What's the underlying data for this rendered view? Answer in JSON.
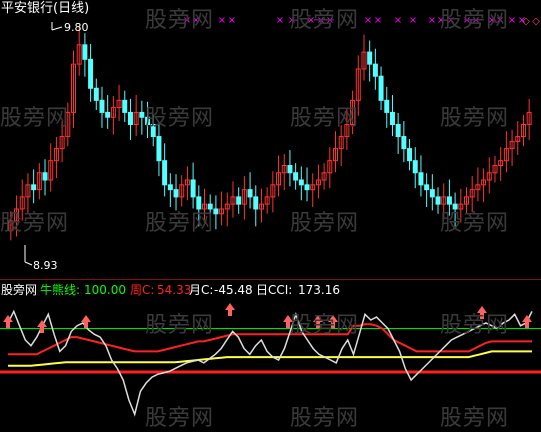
{
  "chart_title": "平安银行(日线)",
  "upper_panel": {
    "max_price_label": "9.80",
    "min_price_label": "8.93",
    "marker_glyph": "×",
    "diamond_glyph": "◇",
    "marker_color": "#ff00ff",
    "up_color": "#ff3232",
    "down_color": "#54ffff"
  },
  "watermark_text": "股旁网",
  "indicator_bar": {
    "name": "股旁网",
    "bull_line_label": "牛熊线:",
    "bull_line_value": "100.00",
    "week_label": "周C:",
    "week_value": "54.33",
    "month_label": "月C:",
    "month_value": "-45.48",
    "day_label": "日CCI:",
    "day_value": "173.16"
  },
  "colors": {
    "bull_line": "#00ff00",
    "week": "#ff2020",
    "month": "#ffff40",
    "day": "#dddddd",
    "divider": "#7a1010",
    "arrow": "#ff6060"
  },
  "chart_data": [
    {
      "type": "candlestick",
      "title": "平安银行(日线)",
      "annotations": [
        "9.80",
        "8.93"
      ],
      "close": [
        9.05,
        9.1,
        9.15,
        9.2,
        9.18,
        9.25,
        9.22,
        9.3,
        9.35,
        9.4,
        9.5,
        9.7,
        9.78,
        9.72,
        9.6,
        9.55,
        9.5,
        9.48,
        9.52,
        9.55,
        9.5,
        9.45,
        9.5,
        9.48,
        9.45,
        9.4,
        9.3,
        9.2,
        9.18,
        9.15,
        9.2,
        9.22,
        9.15,
        9.1,
        9.12,
        9.1,
        9.08,
        9.1,
        9.12,
        9.15,
        9.12,
        9.18,
        9.15,
        9.1,
        9.12,
        9.15,
        9.2,
        9.25,
        9.28,
        9.25,
        9.22,
        9.2,
        9.18,
        9.2,
        9.22,
        9.25,
        9.3,
        9.35,
        9.4,
        9.45,
        9.55,
        9.68,
        9.75,
        9.7,
        9.65,
        9.55,
        9.5,
        9.45,
        9.4,
        9.35,
        9.3,
        9.25,
        9.2,
        9.18,
        9.15,
        9.12,
        9.15,
        9.12,
        9.1,
        9.12,
        9.15,
        9.18,
        9.2,
        9.22,
        9.25,
        9.28,
        9.3,
        9.35,
        9.38,
        9.4,
        9.45,
        9.5
      ],
      "ylim": [
        8.93,
        9.8
      ]
    },
    {
      "type": "line",
      "title": "股旁网",
      "series": [
        {
          "name": "牛熊线",
          "last": 100.0
        },
        {
          "name": "周C",
          "last": 54.33
        },
        {
          "name": "月C",
          "last": -45.48
        },
        {
          "name": "日CCI",
          "last": 173.16
        }
      ],
      "series_values": {
        "day_cci": [
          120,
          160,
          110,
          60,
          40,
          70,
          110,
          150,
          80,
          20,
          40,
          90,
          110,
          120,
          95,
          80,
          70,
          40,
          -10,
          -40,
          -80,
          -150,
          -200,
          -120,
          -90,
          -70,
          -60,
          -55,
          -50,
          -40,
          -30,
          -20,
          -15,
          -10,
          -20,
          -5,
          10,
          30,
          60,
          90,
          70,
          30,
          10,
          40,
          60,
          20,
          0,
          -10,
          30,
          90,
          150,
          90,
          60,
          30,
          10,
          0,
          -10,
          -20,
          30,
          60,
          10,
          80,
          150,
          130,
          140,
          120,
          100,
          60,
          20,
          -40,
          -80,
          -60,
          -40,
          -20,
          0,
          20,
          40,
          60,
          70,
          80,
          90,
          100,
          110,
          120,
          110,
          100,
          120,
          130,
          150,
          110,
          120,
          160
        ],
        "week_c": [
          10,
          10,
          10,
          10,
          10,
          10,
          20,
          30,
          40,
          50,
          60,
          70,
          70,
          65,
          60,
          55,
          50,
          45,
          40,
          35,
          30,
          25,
          20,
          20,
          20,
          20,
          20,
          25,
          30,
          35,
          40,
          45,
          50,
          55,
          55,
          60,
          65,
          70,
          75,
          80,
          80,
          80,
          80,
          80,
          80,
          80,
          80,
          80,
          80,
          80,
          80,
          80,
          80,
          80,
          80,
          80,
          80,
          80,
          80,
          80,
          110,
          110,
          115,
          115,
          110,
          100,
          80,
          60,
          50,
          40,
          30,
          20,
          20,
          20,
          20,
          20,
          20,
          20,
          20,
          20,
          20,
          30,
          40,
          50,
          55,
          55,
          55,
          55,
          55,
          55,
          55,
          55
        ],
        "month_c": [
          -30,
          -30,
          -30,
          -30,
          -30,
          -28,
          -26,
          -24,
          -22,
          -20,
          -18,
          -18,
          -18,
          -18,
          -18,
          -18,
          -18,
          -18,
          -18,
          -18,
          -18,
          -18,
          -18,
          -18,
          -18,
          -18,
          -18,
          -18,
          -18,
          -18,
          -16,
          -14,
          -12,
          -10,
          -8,
          -6,
          -4,
          -2,
          0,
          0,
          0,
          0,
          0,
          0,
          0,
          0,
          0,
          0,
          0,
          0,
          0,
          0,
          0,
          0,
          0,
          0,
          0,
          0,
          0,
          0,
          0,
          0,
          0,
          0,
          0,
          0,
          0,
          0,
          0,
          0,
          0,
          0,
          0,
          0,
          0,
          0,
          0,
          0,
          0,
          0,
          0,
          5,
          10,
          15,
          20,
          20,
          20,
          20,
          20,
          20,
          20,
          20
        ]
      },
      "ylim": [
        -220,
        200
      ]
    }
  ]
}
